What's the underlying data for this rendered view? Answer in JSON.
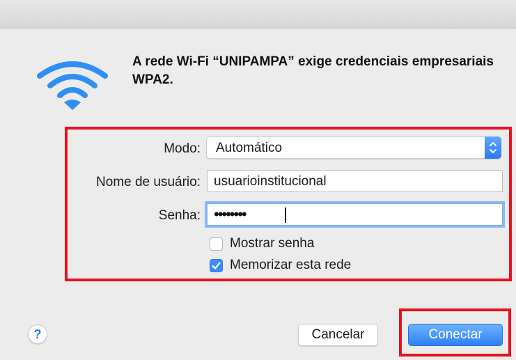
{
  "dialog": {
    "message": "A rede Wi-Fi “UNIPAMPA” exige credenciais empresariais WPA2."
  },
  "form": {
    "mode_label": "Modo:",
    "mode_value": "Automático",
    "username_label": "Nome de usuário:",
    "username_value": "usuarioinstitucional",
    "password_label": "Senha:",
    "password_masked": "••••••••",
    "show_password_label": "Mostrar senha",
    "show_password_checked": false,
    "remember_network_label": "Memorizar esta rede",
    "remember_network_checked": true
  },
  "buttons": {
    "help_label": "?",
    "cancel_label": "Cancelar",
    "connect_label": "Conectar"
  },
  "icons": {
    "wifi": "wifi-icon",
    "help": "question-icon",
    "stepper": "up-down-chevron-icon",
    "check": "checkmark-icon"
  },
  "colors": {
    "accent": "#2f7ff5",
    "highlight_border": "#e8111d",
    "background": "#ececec"
  }
}
